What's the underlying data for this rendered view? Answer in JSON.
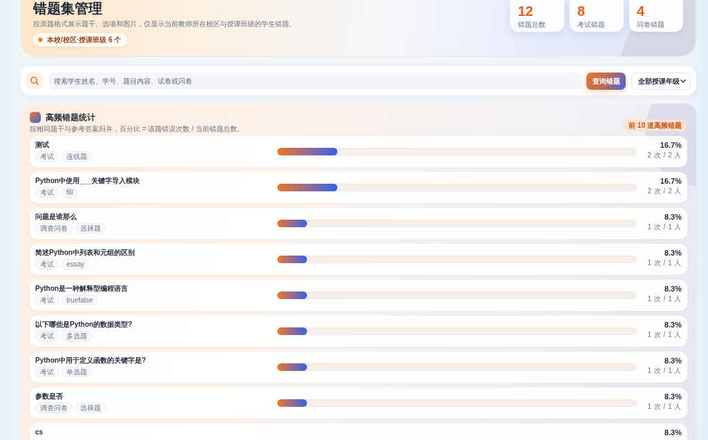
{
  "page": {
    "title": "错题集管理",
    "subtitle": "按原题格式展示题干、选项和图片，仅显示当前教师所在校区与授课班级的学生错题。",
    "scope_badge": "本校/校区·授课班级 6 个"
  },
  "stats": [
    {
      "value": "12",
      "label": "错题总数"
    },
    {
      "value": "8",
      "label": "考试错题"
    },
    {
      "value": "4",
      "label": "问卷错题"
    }
  ],
  "search": {
    "placeholder": "搜索学生姓名、学号、题目内容、试卷或问卷",
    "button": "查询错题",
    "grade_filter": "全部授课年级"
  },
  "frequent_errors": {
    "title": "高频错题统计",
    "subtitle": "按相同题干与参考答案归并，百分比 = 该题错误次数 / 当前错题总数。",
    "badge": "前 10 道高频错题",
    "rows": [
      {
        "title": "测试",
        "tags": [
          "考试",
          "连线题"
        ],
        "level": 0.167,
        "percent": "16.7%",
        "count": "2 次 / 2 人"
      },
      {
        "title": "Python中使用___关键字导入模块",
        "tags": [
          "考试",
          "fill"
        ],
        "level": 0.167,
        "percent": "16.7%",
        "count": "2 次 / 2 人"
      },
      {
        "title": "问题是谁那么",
        "tags": [
          "调查问卷",
          "选择题"
        ],
        "level": 0.083,
        "percent": "8.3%",
        "count": "1 次 / 1 人"
      },
      {
        "title": "简述Python中列表和元组的区别",
        "tags": [
          "考试",
          "essay"
        ],
        "level": 0.083,
        "percent": "8.3%",
        "count": "1 次 / 1 人"
      },
      {
        "title": "Python是一种解释型编程语言",
        "tags": [
          "考试",
          "truefalse"
        ],
        "level": 0.083,
        "percent": "8.3%",
        "count": "1 次 / 1 人"
      },
      {
        "title": "以下哪些是Python的数据类型?",
        "tags": [
          "考试",
          "多选题"
        ],
        "level": 0.083,
        "percent": "8.3%",
        "count": "1 次 / 1 人"
      },
      {
        "title": "Python中用于定义函数的关键字是?",
        "tags": [
          "考试",
          "单选题"
        ],
        "level": 0.083,
        "percent": "8.3%",
        "count": "1 次 / 1 人"
      },
      {
        "title": "参数是否",
        "tags": [
          "调查问卷",
          "选择题"
        ],
        "level": 0.083,
        "percent": "8.3%",
        "count": "1 次 / 1 人"
      },
      {
        "title": "cs",
        "percent": "8.3%"
      }
    ]
  }
}
